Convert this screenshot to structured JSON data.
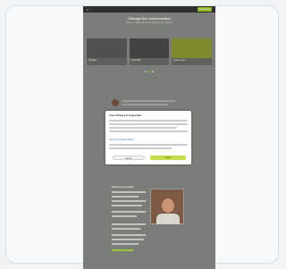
{
  "site": {
    "logo": "≡",
    "cta_label": "Subscribe"
  },
  "hero": {
    "title": "Change the conversation",
    "subtitle": "Stories, ideas and community for our readers"
  },
  "thumbnails": [
    {
      "caption": "Speaker",
      "color": "#50524f"
    },
    {
      "caption": "Panel talk",
      "color": "#444240"
    },
    {
      "caption": "Green event",
      "color": "#7f8a2e"
    }
  ],
  "carousel": {
    "count": 3,
    "active": 1
  },
  "modal": {
    "title": "Your Privacy Is Important",
    "link_text": "Learn more about cookies",
    "decline_label": "Decline",
    "accept_label": "Accept"
  },
  "section": {
    "title": "Featured speaker"
  },
  "colors": {
    "accent": "#8fb51f",
    "accept_button": "#c3e04c",
    "page_overlay": "#7a7d79"
  }
}
